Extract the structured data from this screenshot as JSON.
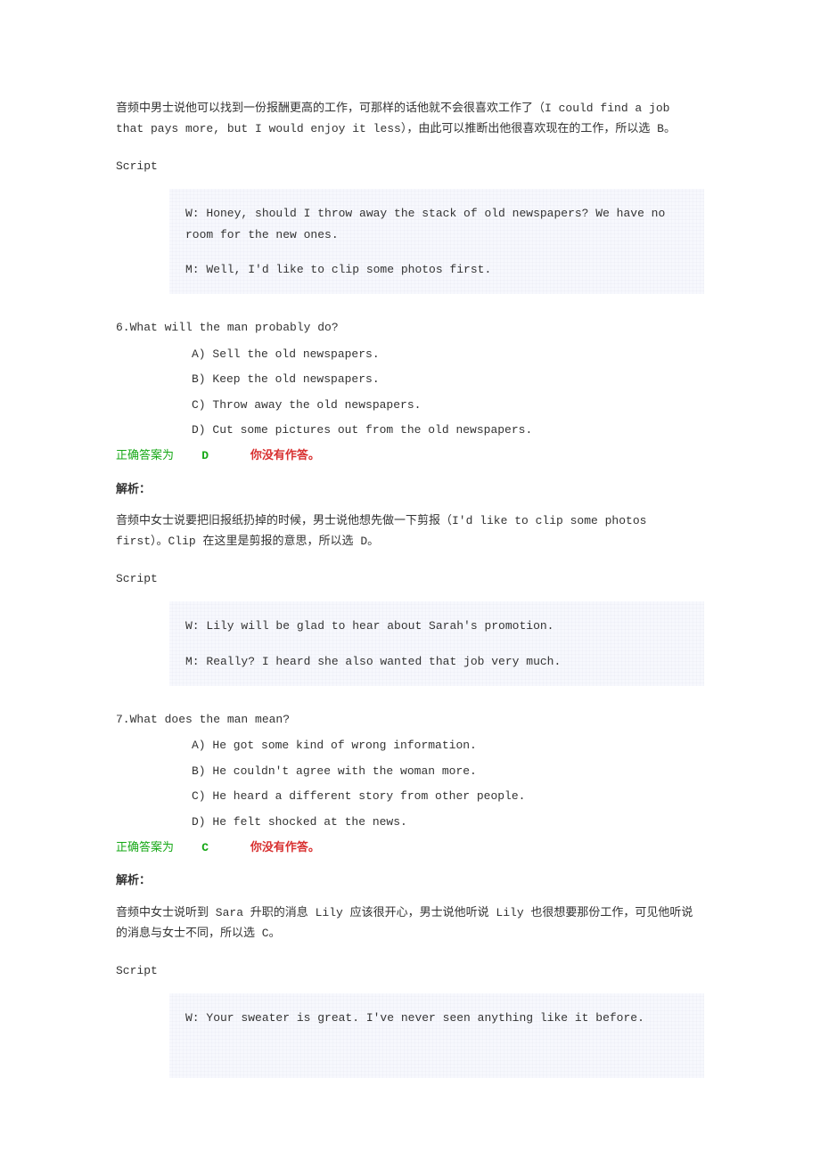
{
  "intro_explain": "音频中男士说他可以找到一份报酬更高的工作，可那样的话他就不会很喜欢工作了（I could find a job that pays more, but I would enjoy it less），由此可以推断出他很喜欢现在的工作，所以选 B。",
  "script_label": "Script",
  "jiexi_label": "解析：",
  "answer_prefix": "正确答案为",
  "not_answered": "你没有作答。",
  "q6": {
    "script": {
      "w": "W: Honey, should I throw away the stack of old newspapers? We have no room for the new ones.",
      "m": "M: Well, I'd like to clip some photos first."
    },
    "question": "6.What will the man probably do?",
    "a": "A) Sell the old newspapers.",
    "b": "B) Keep the old newspapers.",
    "c": "C) Throw away the old newspapers.",
    "d": "D) Cut some pictures out from the old newspapers.",
    "answer": "D",
    "explain": "音频中女士说要把旧报纸扔掉的时候，男士说他想先做一下剪报（I'd like to clip some photos first）。Clip 在这里是剪报的意思，所以选 D。"
  },
  "q7": {
    "script": {
      "w": "W: Lily will be glad to hear about Sarah's promotion.",
      "m": "M: Really? I heard she also wanted that job very much."
    },
    "question": "7.What does the man mean?",
    "a": "A) He got some kind of wrong information.",
    "b": "B) He couldn't agree with the woman more.",
    "c": "C) He heard a different story from other people.",
    "d": "D) He felt shocked at the news.",
    "answer": "C",
    "explain": "音频中女士说听到 Sara 升职的消息 Lily 应该很开心，男士说他听说 Lily 也很想要那份工作，可见他听说的消息与女士不同，所以选 C。"
  },
  "q8": {
    "script": {
      "w": "W: Your sweater is great. I've never seen anything like it before."
    }
  }
}
